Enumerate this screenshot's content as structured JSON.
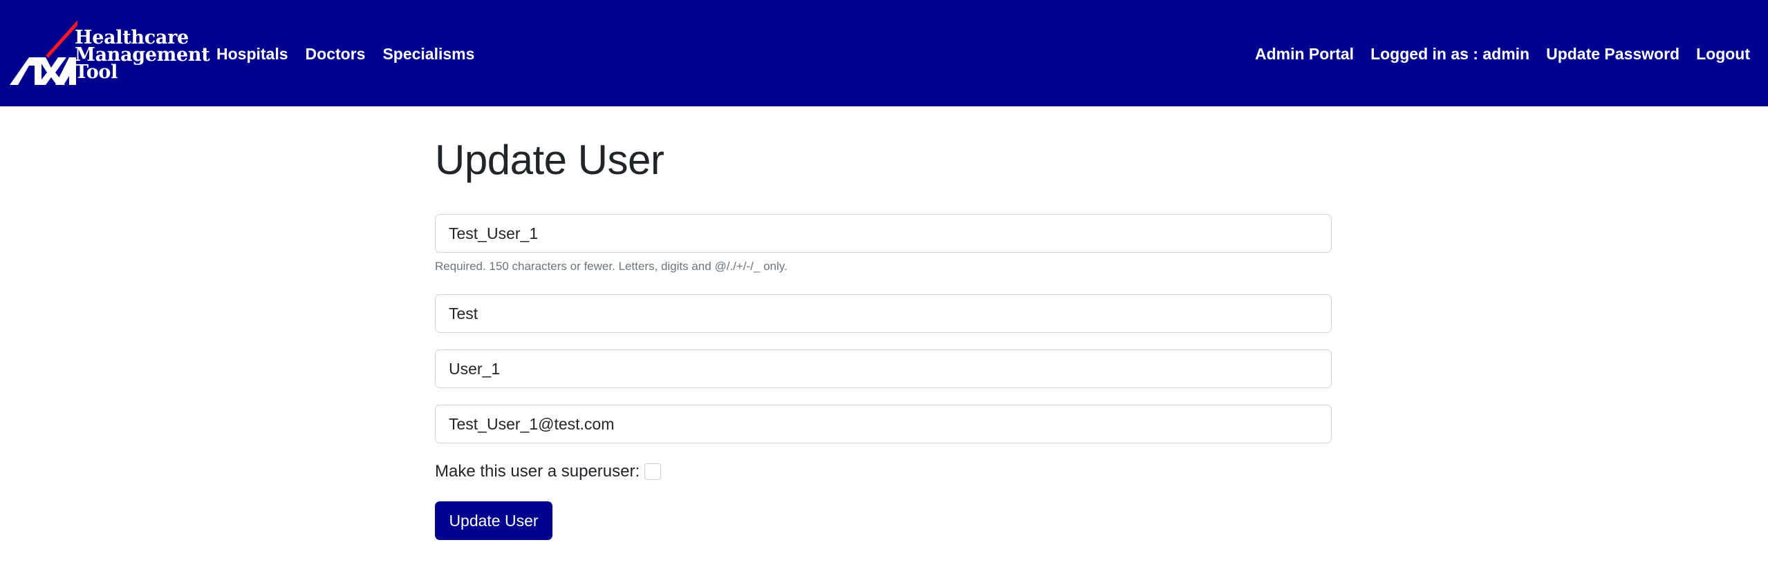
{
  "navbar": {
    "brand": {
      "logo_text": "AXA",
      "title_lines": [
        "Healthcare",
        "Management",
        "Tool"
      ]
    },
    "left_links": [
      "Hospitals",
      "Doctors",
      "Specialisms"
    ],
    "right_links": {
      "admin_portal": "Admin Portal",
      "logged_in": "Logged in as : admin",
      "update_password": "Update Password",
      "logout": "Logout"
    },
    "colors": {
      "background": "#00008f",
      "accent_slash": "#ff1721"
    }
  },
  "form": {
    "title": "Update User",
    "username": "Test_User_1",
    "username_help": "Required. 150 characters or fewer. Letters, digits and @/./+/-/_ only.",
    "first_name": "Test",
    "last_name": "User_1",
    "email": "Test_User_1@test.com",
    "superuser_label": "Make this user a superuser:",
    "superuser_checked": false,
    "submit_label": "Update User"
  }
}
